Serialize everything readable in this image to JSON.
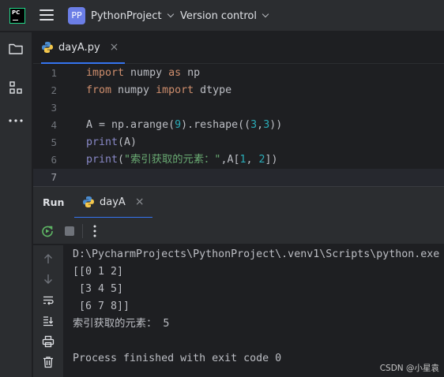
{
  "topbar": {
    "logo_text": "PC",
    "project_badge": "PP",
    "project_name": "PythonProject",
    "vcs_label": "Version control"
  },
  "editor": {
    "tab_label": "dayA.py",
    "line_numbers": [
      "1",
      "2",
      "3",
      "4",
      "5",
      "6",
      "7"
    ],
    "lines": {
      "l1": {
        "kw1": "import",
        "t1": " numpy ",
        "kw2": "as",
        "t2": " np"
      },
      "l2": {
        "kw1": "from",
        "t1": " numpy ",
        "kw2": "import",
        "t2": " dtype"
      },
      "l4": {
        "t1": "A = np.arange(",
        "n1": "9",
        "t2": ").reshape((",
        "n2": "3",
        "t3": ",",
        "n3": "3",
        "t4": "))"
      },
      "l5": {
        "fn": "print",
        "t1": "(A)"
      },
      "l6": {
        "fn": "print",
        "t1": "(",
        "s1": "\"索引获取的元素：\"",
        "t2": ",A[",
        "n1": "1",
        "t3": ", ",
        "n2": "2",
        "t4": "])"
      }
    }
  },
  "run": {
    "title": "Run",
    "tab_label": "dayA"
  },
  "console": {
    "lines": [
      "D:\\PycharmProjects\\PythonProject\\.venv1\\Scripts\\python.exe",
      "[[0 1 2]",
      " [3 4 5]",
      " [6 7 8]]",
      "索引获取的元素： 5",
      "",
      "Process finished with exit code 0"
    ]
  },
  "watermark": "CSDN @小星袁",
  "colors": {
    "accent": "#3574f0",
    "badge": "#6b7ee6",
    "keyword": "#cf8e6d",
    "string": "#6aab73",
    "number": "#2aacb8",
    "builtin": "#8888c6"
  }
}
